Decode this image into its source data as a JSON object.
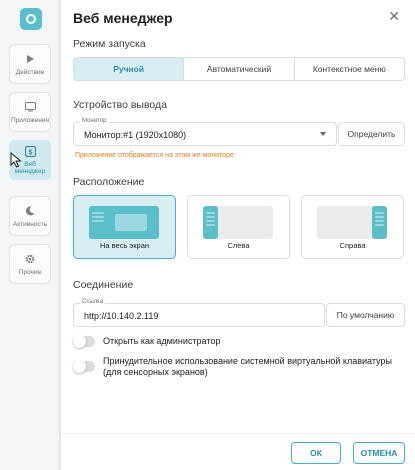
{
  "sidebar": {
    "items": [
      {
        "label": "Действие",
        "icon": "play-icon"
      },
      {
        "label": "Приложения",
        "icon": "monitor-icon"
      },
      {
        "label": "Веб менеджер",
        "icon": "web-manager-icon"
      },
      {
        "label": "Активность",
        "icon": "moon-icon"
      },
      {
        "label": "Прочие",
        "icon": "gear-icon"
      }
    ],
    "active_index": 2
  },
  "dialog": {
    "title": "Веб менеджер",
    "close_glyph": "✕"
  },
  "launch": {
    "heading": "Режим запуска",
    "options": [
      "Ручной",
      "Автоматический",
      "Контекстное меню"
    ],
    "selected": "Ручной"
  },
  "output": {
    "heading": "Устройство вывода",
    "monitor_label": "Монитор",
    "monitor_value": "Монитор:#1 (1920x1080)",
    "detect_button": "Определить",
    "warning": "Приложение отображается на этом же мониторе"
  },
  "placement": {
    "heading": "Расположение",
    "options": [
      "На весь экран",
      "Слева",
      "Справа"
    ],
    "selected": "На весь экран"
  },
  "connection": {
    "heading": "Соединение",
    "link_label": "Ссылка",
    "link_value": "http://10.140.2.119",
    "default_button": "По умолчанию"
  },
  "toggles": [
    {
      "label": "Открыть как администратор",
      "on": false
    },
    {
      "label": "Принудительное использование системной виртуальной клавиатуры (для сенсорных экранов)",
      "on": false
    }
  ],
  "footer": {
    "ok": "ОК",
    "cancel": "ОТМЕНА"
  },
  "colors": {
    "accent": "#5bbfca",
    "accent_text": "#2a8fa0",
    "warning": "#e37c22"
  }
}
